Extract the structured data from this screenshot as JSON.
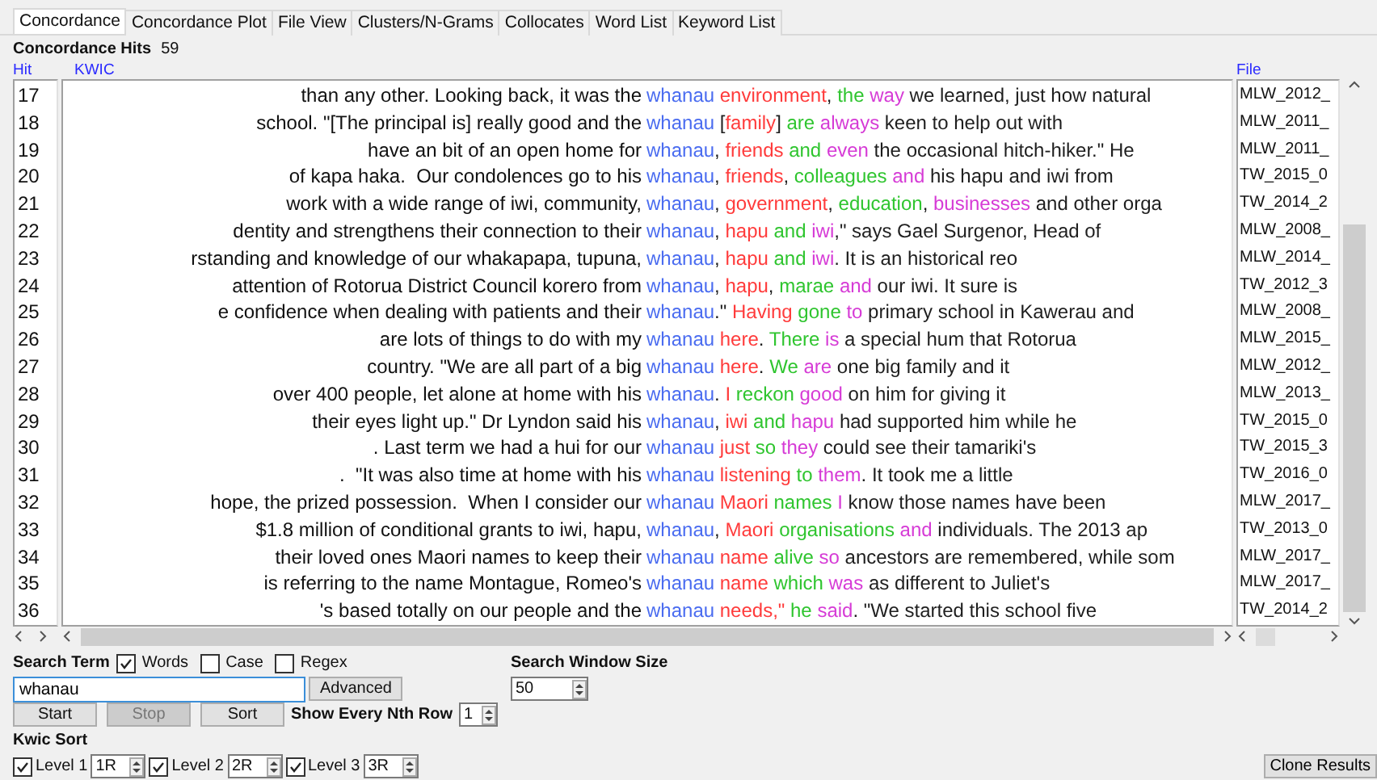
{
  "tabs": [
    {
      "label": "Concordance",
      "selected": true
    },
    {
      "label": "Concordance Plot",
      "selected": false
    },
    {
      "label": "File View",
      "selected": false
    },
    {
      "label": "Clusters/N-Grams",
      "selected": false
    },
    {
      "label": "Collocates",
      "selected": false
    },
    {
      "label": "Word List",
      "selected": false
    },
    {
      "label": "Keyword List",
      "selected": false
    }
  ],
  "hits": {
    "label": "Concordance Hits",
    "count": "59"
  },
  "columns": {
    "hit": "Hit",
    "kwic": "KWIC",
    "file": "File"
  },
  "rows": [
    {
      "hit": "17",
      "left": "than any other. Looking back, it was the",
      "keyword": "whanau",
      "right": [
        {
          "text": " environment",
          "color": "#ff3b3b"
        },
        {
          "lead": ", ",
          "text": "the",
          "color": "#2fc52f"
        },
        {
          "text": " way",
          "color": "#d63bd6"
        },
        {
          "text": " we learned, just how natural"
        }
      ],
      "file": "MLW_2012_"
    },
    {
      "hit": "18",
      "left": "school. \"[The principal is] really good and the",
      "keyword": "whanau",
      "right": [
        {
          "lead": " [",
          "text": "family",
          "color": "#ff3b3b"
        },
        {
          "lead": "] ",
          "text": "are",
          "color": "#2fc52f"
        },
        {
          "text": " always",
          "color": "#d63bd6"
        },
        {
          "text": " keen to help out with"
        }
      ],
      "file": "MLW_2011_"
    },
    {
      "hit": "19",
      "left": "have an bit of an open home for",
      "keyword": "whanau",
      "right": [
        {
          "lead": ", ",
          "text": "friends",
          "color": "#ff3b3b"
        },
        {
          "text": " and",
          "color": "#2fc52f"
        },
        {
          "text": " even",
          "color": "#d63bd6"
        },
        {
          "text": " the occasional hitch-hiker.\" He"
        }
      ],
      "file": "MLW_2011_"
    },
    {
      "hit": "20",
      "left": "of kapa haka.  Our condolences go to his",
      "keyword": "whanau",
      "right": [
        {
          "lead": ", ",
          "text": "friends",
          "color": "#ff3b3b"
        },
        {
          "lead": ", ",
          "text": "colleagues",
          "color": "#2fc52f"
        },
        {
          "text": " and",
          "color": "#d63bd6"
        },
        {
          "text": " his hapu and iwi from"
        }
      ],
      "file": "TW_2015_0"
    },
    {
      "hit": "21",
      "left": "work with a wide range of iwi, community,",
      "keyword": "whanau",
      "right": [
        {
          "lead": ", ",
          "text": "government",
          "color": "#ff3b3b"
        },
        {
          "lead": ", ",
          "text": "education",
          "color": "#2fc52f"
        },
        {
          "lead": ", ",
          "text": "businesses",
          "color": "#d63bd6"
        },
        {
          "text": " and other orga"
        }
      ],
      "file": "TW_2014_2"
    },
    {
      "hit": "22",
      "left": "dentity and strengthens their connection to their",
      "keyword": "whanau",
      "right": [
        {
          "lead": ", ",
          "text": "hapu",
          "color": "#ff3b3b"
        },
        {
          "text": " and",
          "color": "#2fc52f"
        },
        {
          "text": " iwi",
          "color": "#d63bd6"
        },
        {
          "text": ",\" says Gael Surgenor, Head of"
        }
      ],
      "file": "MLW_2008_"
    },
    {
      "hit": "23",
      "left": "rstanding and knowledge of our whakapapa, tupuna,",
      "keyword": "whanau",
      "right": [
        {
          "lead": ", ",
          "text": "hapu",
          "color": "#ff3b3b"
        },
        {
          "text": " and",
          "color": "#2fc52f"
        },
        {
          "text": " iwi",
          "color": "#d63bd6"
        },
        {
          "text": ". It is an historical reo"
        }
      ],
      "file": "MLW_2014_"
    },
    {
      "hit": "24",
      "left": "attention of Rotorua District Council korero from",
      "keyword": "whanau",
      "right": [
        {
          "lead": ", ",
          "text": "hapu",
          "color": "#ff3b3b"
        },
        {
          "lead": ", ",
          "text": "marae",
          "color": "#2fc52f"
        },
        {
          "text": " and",
          "color": "#d63bd6"
        },
        {
          "text": " our iwi. It sure is"
        }
      ],
      "file": "TW_2012_3"
    },
    {
      "hit": "25",
      "left": "e confidence when dealing with patients and their",
      "keyword": "whanau",
      "right": [
        {
          "lead": ".\" ",
          "text": "Having",
          "color": "#ff3b3b"
        },
        {
          "text": " gone",
          "color": "#2fc52f"
        },
        {
          "text": " to",
          "color": "#d63bd6"
        },
        {
          "text": " primary school in Kawerau and"
        }
      ],
      "file": "MLW_2008_"
    },
    {
      "hit": "26",
      "left": "are lots of things to do with my",
      "keyword": "whanau",
      "right": [
        {
          "text": " here",
          "color": "#ff3b3b"
        },
        {
          "lead": ". ",
          "text": "There",
          "color": "#2fc52f"
        },
        {
          "text": " is",
          "color": "#d63bd6"
        },
        {
          "text": " a special hum that Rotorua"
        }
      ],
      "file": "MLW_2015_"
    },
    {
      "hit": "27",
      "left": "country. \"We are all part of a big",
      "keyword": "whanau",
      "right": [
        {
          "text": " here",
          "color": "#ff3b3b"
        },
        {
          "lead": ". ",
          "text": "We",
          "color": "#2fc52f"
        },
        {
          "text": " are",
          "color": "#d63bd6"
        },
        {
          "text": " one big family and it"
        }
      ],
      "file": "MLW_2012_"
    },
    {
      "hit": "28",
      "left": "over 400 people, let alone at home with his",
      "keyword": "whanau",
      "right": [
        {
          "lead": ". ",
          "text": "I",
          "color": "#ff3b3b"
        },
        {
          "text": " reckon",
          "color": "#2fc52f"
        },
        {
          "text": " good",
          "color": "#d63bd6"
        },
        {
          "text": " on him for giving it"
        }
      ],
      "file": "MLW_2013_"
    },
    {
      "hit": "29",
      "left": "their eyes light up.\" Dr Lyndon said his",
      "keyword": "whanau",
      "right": [
        {
          "lead": ", ",
          "text": "iwi",
          "color": "#ff3b3b"
        },
        {
          "text": " and",
          "color": "#2fc52f"
        },
        {
          "text": " hapu",
          "color": "#d63bd6"
        },
        {
          "text": " had supported him while he"
        }
      ],
      "file": "TW_2015_0"
    },
    {
      "hit": "30",
      "left": ". Last term we had a hui for our",
      "keyword": "whanau",
      "right": [
        {
          "text": " just",
          "color": "#ff3b3b"
        },
        {
          "text": " so",
          "color": "#2fc52f"
        },
        {
          "text": " they",
          "color": "#d63bd6"
        },
        {
          "text": " could see their tamariki's"
        }
      ],
      "file": "TW_2015_3"
    },
    {
      "hit": "31",
      "left": ".  \"It was also time at home with his",
      "keyword": "whanau",
      "right": [
        {
          "text": " listening",
          "color": "#ff3b3b"
        },
        {
          "text": " to",
          "color": "#2fc52f"
        },
        {
          "text": " them",
          "color": "#d63bd6"
        },
        {
          "text": ". It took me a little"
        }
      ],
      "file": "TW_2016_0"
    },
    {
      "hit": "32",
      "left": "hope, the prized possession.  When I consider our",
      "keyword": "whanau",
      "right": [
        {
          "text": " Maori",
          "color": "#ff3b3b"
        },
        {
          "text": " names",
          "color": "#2fc52f"
        },
        {
          "text": " I",
          "color": "#d63bd6"
        },
        {
          "text": " know those names have been"
        }
      ],
      "file": "MLW_2017_"
    },
    {
      "hit": "33",
      "left": "$1.8 million of conditional grants to iwi, hapu,",
      "keyword": "whanau",
      "right": [
        {
          "lead": ", ",
          "text": "Maori",
          "color": "#ff3b3b"
        },
        {
          "text": " organisations",
          "color": "#2fc52f"
        },
        {
          "text": " and",
          "color": "#d63bd6"
        },
        {
          "text": " individuals. The 2013 ap"
        }
      ],
      "file": "TW_2013_0"
    },
    {
      "hit": "34",
      "left": "their loved ones Maori names to keep their",
      "keyword": "whanau",
      "right": [
        {
          "text": " name",
          "color": "#ff3b3b"
        },
        {
          "text": " alive",
          "color": "#2fc52f"
        },
        {
          "text": " so",
          "color": "#d63bd6"
        },
        {
          "text": " ancestors are remembered, while som"
        }
      ],
      "file": "MLW_2017_"
    },
    {
      "hit": "35",
      "left": "is referring to the name Montague, Romeo's",
      "keyword": "whanau",
      "right": [
        {
          "text": " name",
          "color": "#ff3b3b"
        },
        {
          "text": " which",
          "color": "#2fc52f"
        },
        {
          "text": " was",
          "color": "#d63bd6"
        },
        {
          "text": " as different to Juliet's"
        }
      ],
      "file": "MLW_2017_"
    },
    {
      "hit": "36",
      "left": "'s based totally on our people and the",
      "keyword": "whanau",
      "right": [
        {
          "text": " needs,\"",
          "color": "#ff3b3b"
        },
        {
          "text": " he",
          "color": "#2fc52f"
        },
        {
          "text": " said",
          "color": "#d63bd6"
        },
        {
          "text": ". \"We started this school five"
        }
      ],
      "file": "TW_2014_2"
    }
  ],
  "search": {
    "label": "Search Term",
    "options": [
      {
        "label": "Words",
        "checked": true
      },
      {
        "label": "Case",
        "checked": false
      },
      {
        "label": "Regex",
        "checked": false
      }
    ],
    "value": "whanau",
    "advanced": "Advanced"
  },
  "buttons": [
    {
      "label": "Start",
      "disabled": false
    },
    {
      "label": "Stop",
      "disabled": true
    },
    {
      "label": "Sort",
      "disabled": false
    }
  ],
  "nth_row": {
    "label": "Show Every Nth Row",
    "value": "1"
  },
  "window_size": {
    "label": "Search Window Size",
    "value": "50"
  },
  "kwic_sort": {
    "label": "Kwic Sort",
    "levels": [
      {
        "label": "Level 1",
        "checked": true,
        "value": "1R"
      },
      {
        "label": "Level 2",
        "checked": true,
        "value": "2R"
      },
      {
        "label": "Level 3",
        "checked": true,
        "value": "3R"
      }
    ]
  },
  "clone_button": "Clone Results"
}
